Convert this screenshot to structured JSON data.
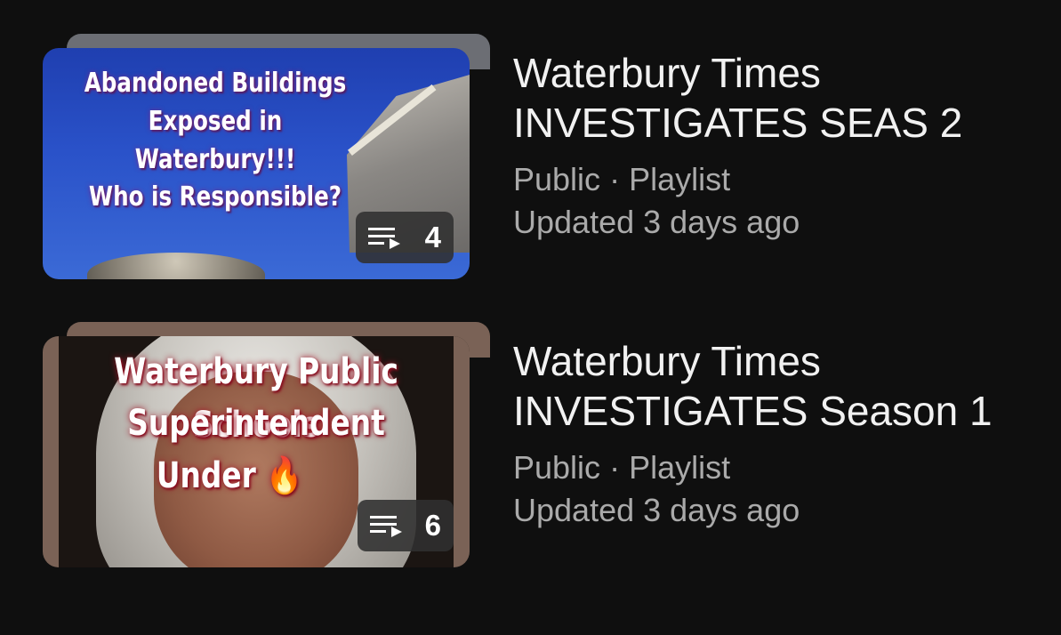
{
  "playlists": [
    {
      "thumbnail_lines": [
        "Abandoned Buildings",
        "Exposed in Waterbury!!!",
        "Who is Responsible?"
      ],
      "video_count": "4",
      "title": "Waterbury Times INVESTIGATES SEAS 2",
      "visibility": "Public",
      "separator": "·",
      "type": "Playlist",
      "updated": "Updated 3 days ago"
    },
    {
      "thumbnail_lines": [
        "Waterbury Public Schools",
        "Superintendent",
        "Under 🔥"
      ],
      "video_count": "6",
      "title": "Waterbury Times INVESTIGATES Season 1",
      "visibility": "Public",
      "separator": "·",
      "type": "Playlist",
      "updated": "Updated 3 days ago"
    }
  ],
  "colors": {
    "background": "#0f0f0f",
    "title": "#f1f1f1",
    "meta": "#aaaaaa"
  },
  "icons": {
    "badge": "playlist-queue-icon"
  }
}
